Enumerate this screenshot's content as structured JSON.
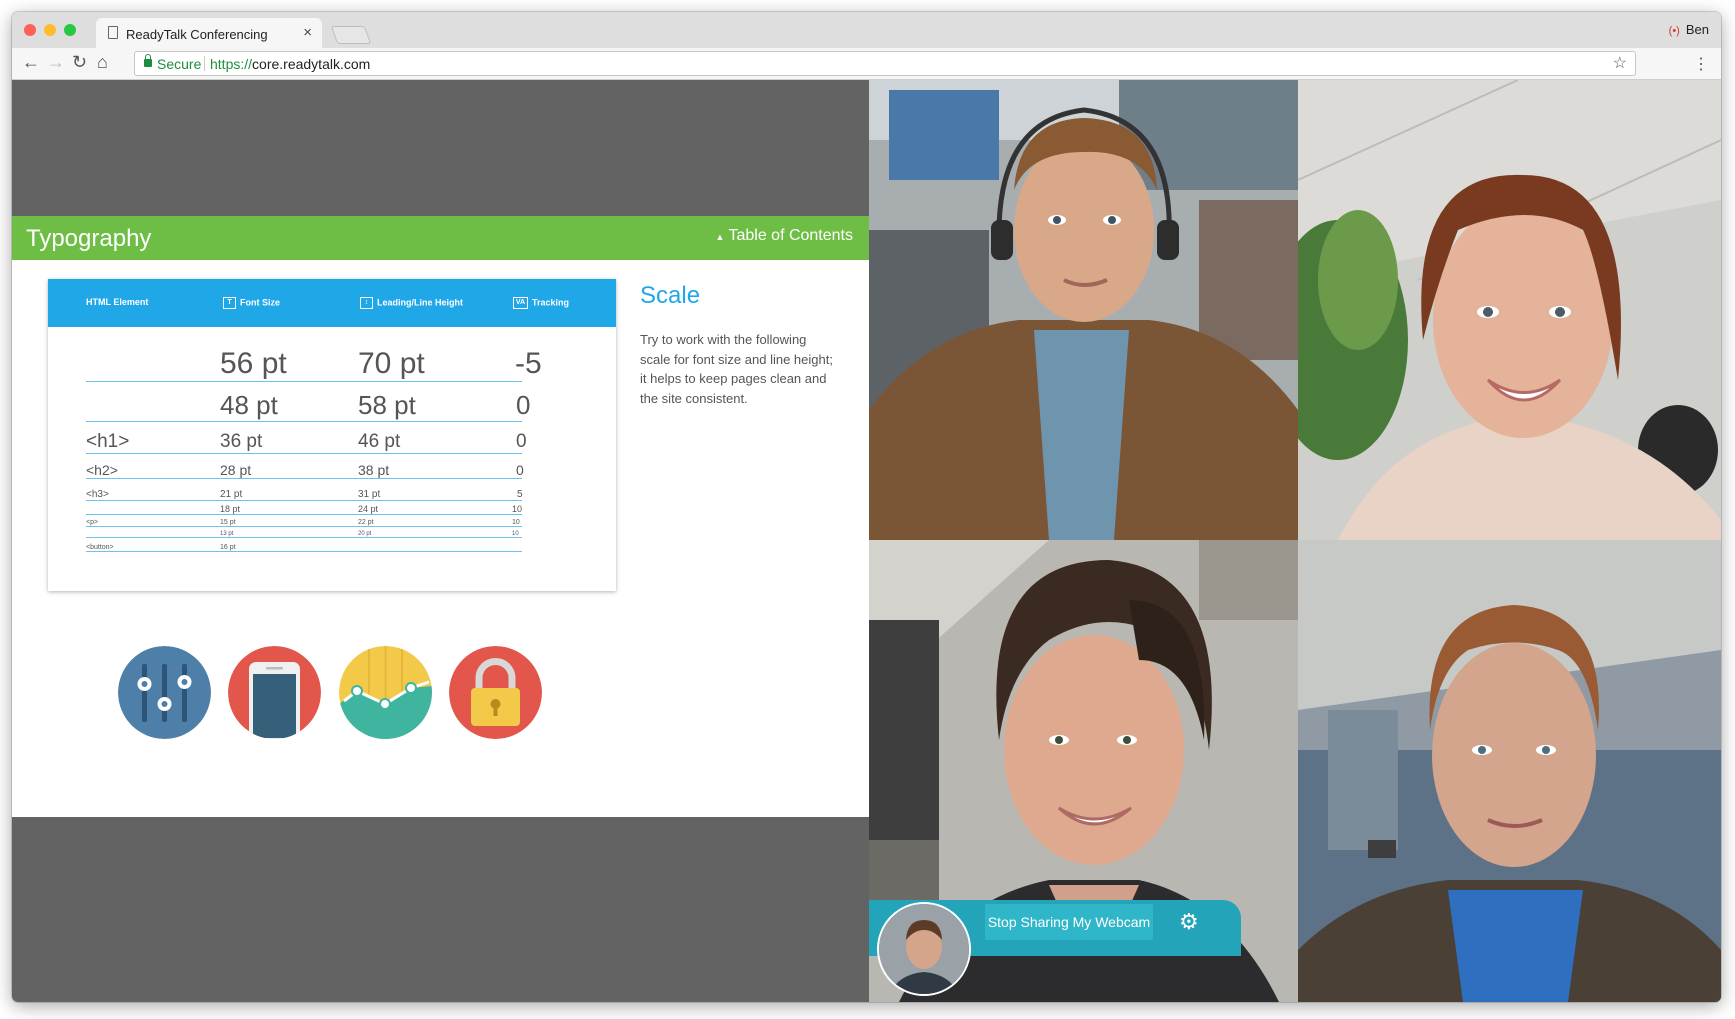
{
  "browser": {
    "tab_title": "ReadyTalk Conferencing",
    "tab_close": "×",
    "profile_name": "Ben",
    "secure_label": "Secure",
    "url_scheme": "https://",
    "url_host": "core.readytalk.com",
    "traffic_colors": [
      "#ff5f57",
      "#febc2e",
      "#28c840"
    ]
  },
  "slide": {
    "section_title": "Typography",
    "toc_label": "Table of Contents",
    "table": {
      "headers": [
        "HTML Element",
        "Font Size",
        "Leading/Line Height",
        "Tracking"
      ],
      "header_icons": [
        "T",
        "↕",
        "VA"
      ],
      "rows": [
        {
          "element": "",
          "font_size": "56 pt",
          "line_height": "70 pt",
          "tracking": "-5"
        },
        {
          "element": "",
          "font_size": "48 pt",
          "line_height": "58 pt",
          "tracking": "0"
        },
        {
          "element": "<h1>",
          "font_size": "36 pt",
          "line_height": "46 pt",
          "tracking": "0"
        },
        {
          "element": "<h2>",
          "font_size": "28 pt",
          "line_height": "38 pt",
          "tracking": "0"
        },
        {
          "element": "<h3>",
          "font_size": "21 pt",
          "line_height": "31 pt",
          "tracking": "5"
        },
        {
          "element": "",
          "font_size": "18 pt",
          "line_height": "24 pt",
          "tracking": "10"
        },
        {
          "element": "<p>",
          "font_size": "15 pt",
          "line_height": "22 pt",
          "tracking": "10"
        },
        {
          "element": "",
          "font_size": "13 pt",
          "line_height": "20 pt",
          "tracking": "10"
        },
        {
          "element": "<button>",
          "font_size": "16 pt",
          "line_height": "",
          "tracking": ""
        }
      ]
    },
    "scale_title": "Scale",
    "scale_text": "Try to work with the following scale for font size and line height; it helps to keep pages clean and the site consistent.",
    "icons": [
      "sliders-icon",
      "phone-icon",
      "chart-icon",
      "padlock-icon"
    ]
  },
  "video": {
    "participants": [
      "participant-1",
      "participant-2",
      "participant-3",
      "participant-4"
    ],
    "stop_label": "Stop Sharing My Webcam",
    "accent": "#23a4b8"
  }
}
